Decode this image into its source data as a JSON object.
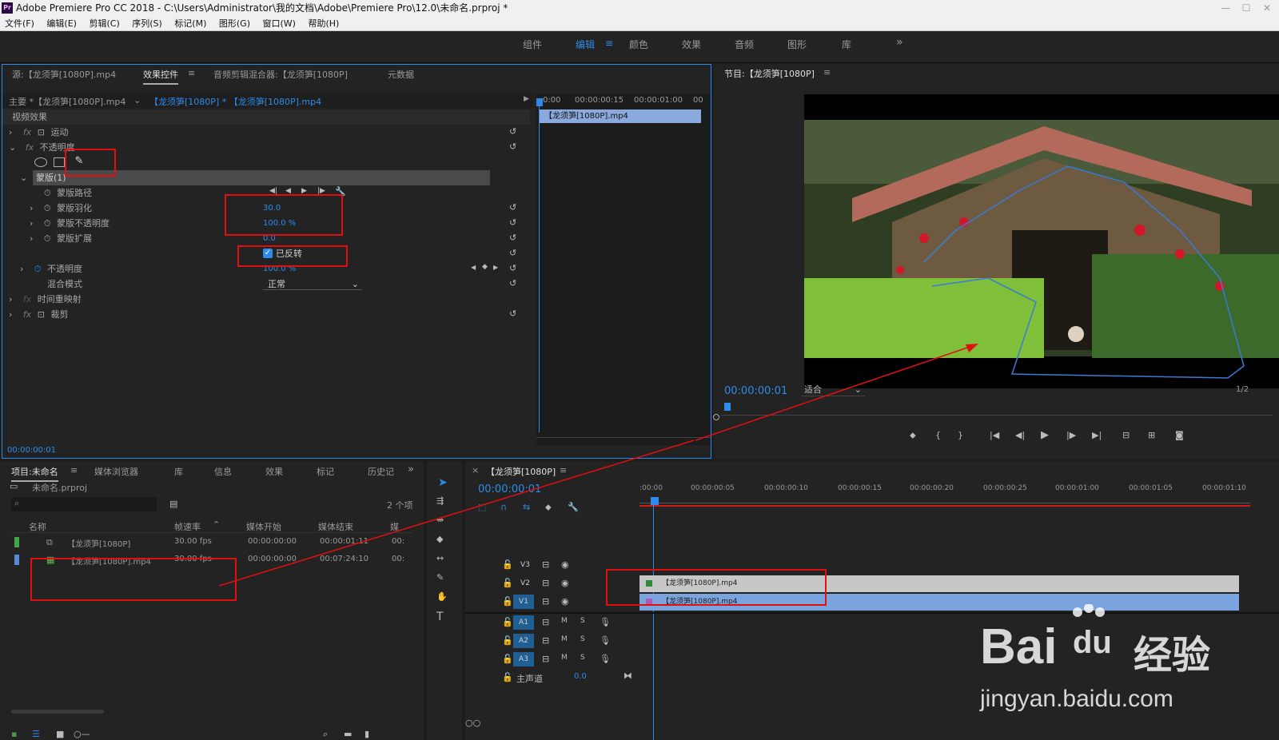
{
  "window": {
    "app_icon": "Pr",
    "title": "Adobe Premiere Pro CC 2018 - C:\\Users\\Administrator\\我的文档\\Adobe\\Premiere Pro\\12.0\\未命名.prproj *"
  },
  "menu": [
    "文件(F)",
    "编辑(E)",
    "剪辑(C)",
    "序列(S)",
    "标记(M)",
    "图形(G)",
    "窗口(W)",
    "帮助(H)"
  ],
  "workspaces": [
    "组件",
    "编辑",
    "颜色",
    "效果",
    "音频",
    "图形",
    "库"
  ],
  "workspace_more": "»",
  "source_panel": {
    "tabs": [
      "源:【龙须笋[1080P].mp4",
      "效果控件",
      "音频剪辑混合器:【龙须笋[1080P]",
      "元数据"
    ],
    "clip_selector": {
      "master": "主要 *【龙须笋[1080P].mp4",
      "sequence": "【龙须笋[1080P] * 【龙须笋[1080P].mp4"
    },
    "section": "视频效果",
    "effects": {
      "motion": "运动",
      "opacity": "不透明度",
      "mask": "蒙版(1)",
      "mask_path": "蒙版路径",
      "mask_feather": "蒙版羽化",
      "mask_opacity": "蒙版不透明度",
      "mask_expansion": "蒙版扩展",
      "opacity_param": "不透明度",
      "blend_mode": "混合模式",
      "time_remap": "时间重映射",
      "crop": "裁剪",
      "fx": "fx"
    },
    "values": {
      "feather": "30.0",
      "mask_opacity": "100.0 %",
      "expansion": "0.0",
      "inverted_label": "已反转",
      "opacity": "100.0 %",
      "blend_mode": "正常"
    },
    "mini_timeline": {
      "times": [
        "0:00",
        "00:00:00:15",
        "00:00:01:00",
        "00"
      ],
      "clip": "【龙须笋[1080P].mp4"
    },
    "timecode": "00:00:00:01"
  },
  "program_monitor": {
    "title": "节目:【龙须笋[1080P]",
    "timecode": "00:00:00:01",
    "fit": "适合",
    "resolution": "1/2"
  },
  "project_panel": {
    "tabs": [
      "项目:未命名",
      "媒体浏览器",
      "库",
      "信息",
      "效果",
      "标记",
      "历史记"
    ],
    "more": "»",
    "project_file": "未命名.prproj",
    "item_count": "2 个项",
    "columns": [
      "名称",
      "帧速率",
      "媒体开始",
      "媒体结束",
      "媒"
    ],
    "rows": [
      {
        "name": "【龙须笋[1080P]",
        "fps": "30.00 fps",
        "start": "00:00:00:00",
        "end": "00:00:01:11",
        "extra": "00:",
        "color": "#3fa84a"
      },
      {
        "name": "【龙须笋[1080P].mp4",
        "fps": "30.00 fps",
        "start": "00:00:00:00",
        "end": "00:07:24:10",
        "extra": "00:",
        "color": "#5a8ad6"
      }
    ]
  },
  "timeline": {
    "tab": "【龙须笋[1080P]",
    "timecode": "00:00:00:01",
    "ruler": [
      ":00:00",
      "00:00:00:05",
      "00:00:00:10",
      "00:00:00:15",
      "00:00:00:20",
      "00:00:00:25",
      "00:00:01:00",
      "00:00:01:05",
      "00:00:01:10"
    ],
    "video_tracks": [
      "V3",
      "V2",
      "V1"
    ],
    "audio_tracks": [
      "A1",
      "A2",
      "A3"
    ],
    "master": {
      "label": "主声道",
      "value": "0.0"
    },
    "clips": {
      "v2": "【龙须笋[1080P].mp4",
      "v1": "【龙须笋[1080P].mp4"
    },
    "ms": [
      "M",
      "S"
    ]
  },
  "watermark": {
    "brand": "Bai",
    "du": "du",
    "cn": "经验",
    "url": "jingyan.baidu.com"
  },
  "colors": {
    "accent": "#2d8ceb",
    "annotation": "#e01010",
    "clip_v1": "#7ba3de",
    "clip_v2": "#c7c7c7"
  }
}
